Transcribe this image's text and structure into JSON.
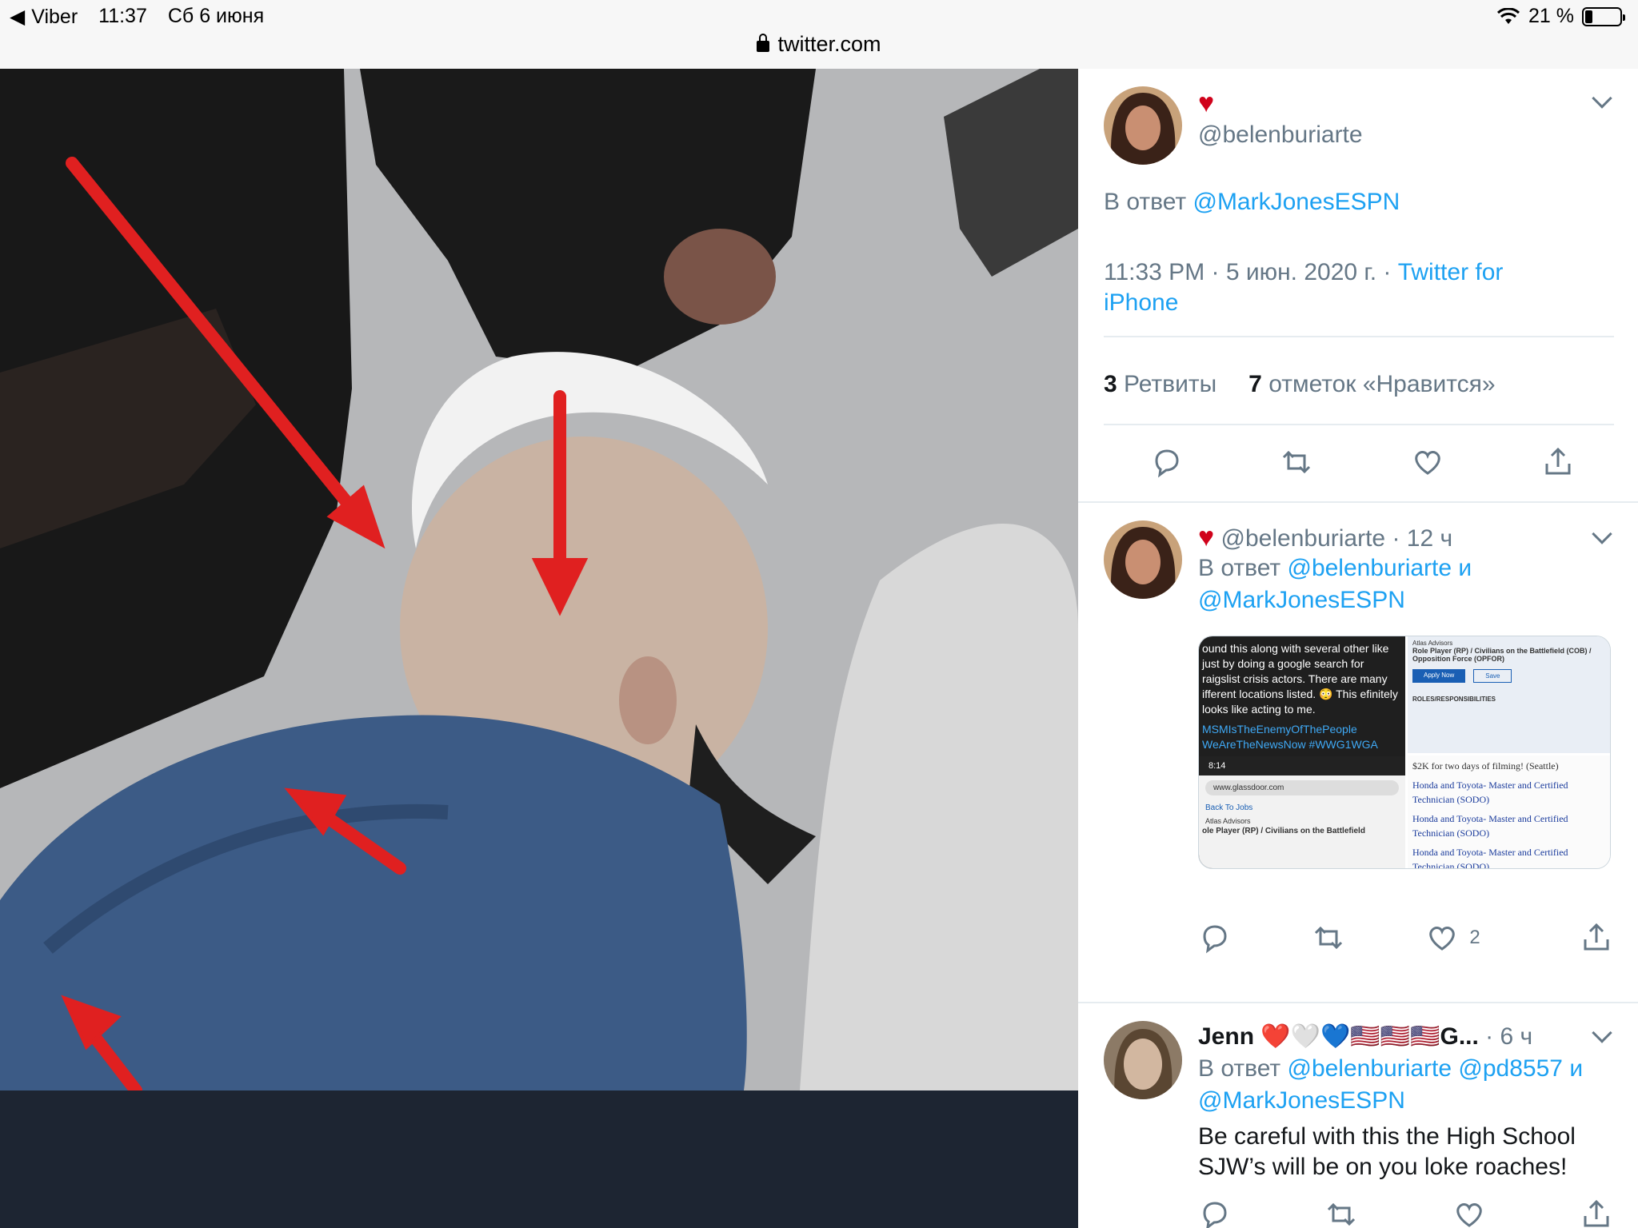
{
  "status_bar": {
    "back_app": "Viber",
    "time": "11:37",
    "date": "Сб 6 июня",
    "battery": "21 %",
    "battery_level": 0.21,
    "url": "twitter.com"
  },
  "main_tweet": {
    "handle": "@belenburiarte",
    "reply_prefix": "В ответ",
    "reply_to": "@MarkJonesESPN",
    "timestamp": "11:33 PM · 5 июн. 2020 г. · ",
    "client": "Twitter for iPhone",
    "retweets_count": "3",
    "retweets_label": "Ретвиты",
    "likes_count": "7",
    "likes_label": "отметок «Нравится»"
  },
  "replies": [
    {
      "handle": "@belenburiarte",
      "time": " · 12 ч",
      "reply_prefix": "В ответ",
      "reply_to_1": "@belenburiarte",
      "reply_and": "и",
      "reply_to_2": "@MarkJonesESPN",
      "like_count": "2",
      "media": {
        "text": "ound this along with several other like just by doing a google search for raigslist crisis actors. There are many ifferent locations listed. 😳 This efinitely looks like acting to me.",
        "tags": "MSMIsTheEnemyOfThePeople WeAreTheNewsNow #WWG1WGA",
        "phone_time": "8:14",
        "phone_url": "www.glassdoor.com",
        "back_to_jobs": "Back To Jobs",
        "company": "Atlas Advisors",
        "role": "ole Player (RP) / Civilians on the Battlefield",
        "right_top_company": "Atlas Advisors",
        "right_top_role": "Role Player (RP) / Civilians on the Battlefield (COB) / Opposition Force (OPFOR)",
        "apply": "Apply Now",
        "save": "Save",
        "roles": "ROLES/RESPONSIBILITIES",
        "list_header": "$2K for two days of filming! (Seattle)",
        "list_item": "Honda and Toyota- Master and Certified Technician (SODO)"
      }
    },
    {
      "name": "Jenn",
      "name_emoji": "❤️🤍💙🇺🇸🇺🇸🇺🇸G...",
      "time": " · 6 ч",
      "reply_prefix": "В ответ",
      "reply_to_1": "@belenburiarte",
      "reply_to_2": "@pd8557",
      "reply_and": "и",
      "reply_to_3": "@MarkJonesESPN",
      "text": "Be careful with this the High School SJW’s will be on you loke roaches!"
    }
  ],
  "colors": {
    "link": "#1da1f2",
    "muted": "#657786",
    "media_bg": "#1d2532",
    "arrow_red": "#e02020"
  }
}
